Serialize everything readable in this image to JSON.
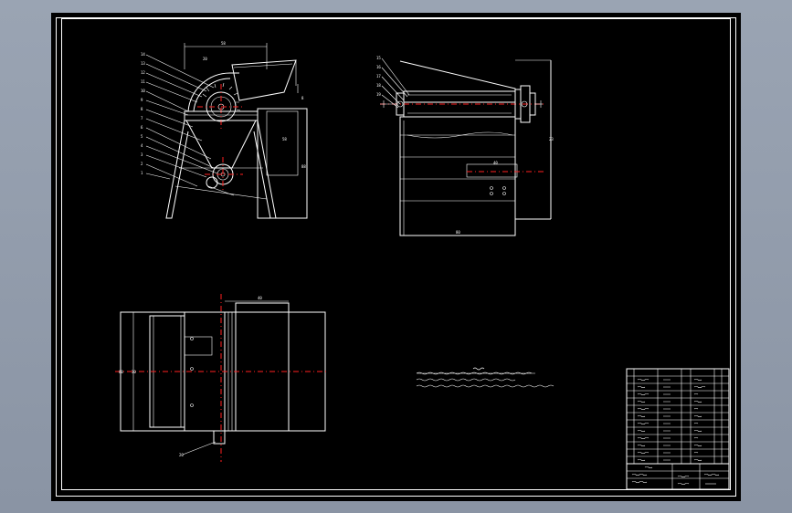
{
  "colors": {
    "background": "#8c96a6",
    "sheet": "#000000",
    "line": "#ffffff",
    "centerline": "#ff2020"
  },
  "drawing": {
    "front_view_dimensions": {
      "top_width": "58",
      "feed_angle": "20",
      "height_total": "88",
      "right_height": "58",
      "small_right": "8"
    },
    "front_view_part_labels": [
      "14",
      "13",
      "12",
      "11",
      "10",
      "9",
      "8",
      "7",
      "6",
      "5",
      "4",
      "3",
      "2",
      "1"
    ],
    "side_view_part_labels": [
      "15",
      "16",
      "17",
      "18",
      "19"
    ],
    "side_view_dimensions": {
      "bottom_width": "80",
      "right_height": "23",
      "inner": "40"
    },
    "plan_view_dimensions": {
      "top_width": "40",
      "left_height": "60",
      "left_inner": "30",
      "bottom_label": "20"
    }
  }
}
